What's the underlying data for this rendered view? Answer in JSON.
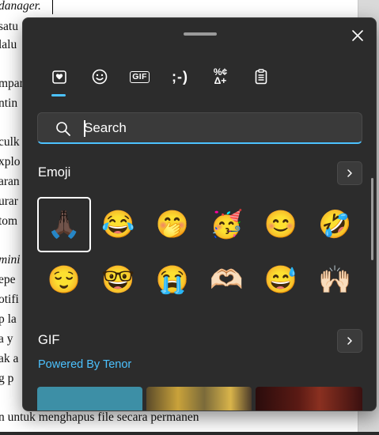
{
  "document": {
    "lines": [
      "danager.",
      "satu",
      " lalu",
      "",
      "mpan",
      "ntin",
      "",
      "culk",
      "xplo",
      "aran",
      "urar",
      "tom",
      "",
      "mini",
      "epe",
      "otifi",
      "p la",
      "a   y",
      "ak  a",
      "g  p",
      "",
      "n untuk menghapus file secara permanen"
    ]
  },
  "panel": {
    "tabs": [
      {
        "name": "favorites",
        "icon": "heart-clipboard-icon",
        "active": true
      },
      {
        "name": "emoji",
        "icon": "smiley-icon",
        "active": false
      },
      {
        "name": "gif",
        "label": "GIF",
        "active": false
      },
      {
        "name": "kaomoji",
        "label": ";-)",
        "active": false
      },
      {
        "name": "symbols",
        "label_top": "%¢",
        "label_bottom": "Δ+",
        "active": false
      },
      {
        "name": "clipboard",
        "icon": "clipboard-icon",
        "active": false
      }
    ],
    "search": {
      "placeholder": "Search",
      "value": ""
    },
    "emoji_section": {
      "title": "Emoji",
      "items": [
        {
          "char": "🙏🏿",
          "name": "folded-hands"
        },
        {
          "char": "😂",
          "name": "face-with-tears-of-joy"
        },
        {
          "char": "🤭",
          "name": "face-with-hand-over-mouth"
        },
        {
          "char": "🥳",
          "name": "partying-face"
        },
        {
          "char": "😊",
          "name": "smiling-face-with-smiling-eyes"
        },
        {
          "char": "🤣",
          "name": "rolling-on-the-floor-laughing"
        },
        {
          "char": "😌",
          "name": "relieved-face"
        },
        {
          "char": "🤓",
          "name": "nerd-face"
        },
        {
          "char": "😭",
          "name": "loudly-crying-face"
        },
        {
          "char": "🫶🏻",
          "name": "heart-hands"
        },
        {
          "char": "😅",
          "name": "grinning-face-with-sweat"
        },
        {
          "char": "🙌🏻",
          "name": "raising-hands"
        }
      ]
    },
    "gif_section": {
      "title": "GIF",
      "powered_by": "Powered By Tenor"
    }
  },
  "colors": {
    "panel_bg": "#2c2c2c",
    "accent": "#4cc2ff",
    "text": "#ffffff"
  }
}
